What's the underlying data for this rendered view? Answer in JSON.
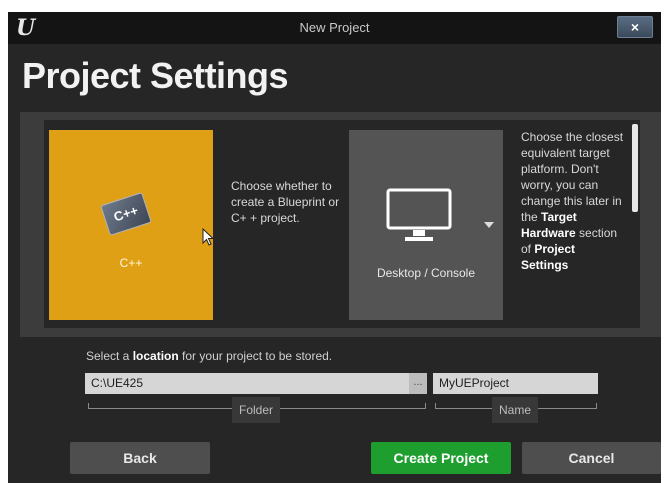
{
  "window": {
    "title": "New Project",
    "close_label": "×"
  },
  "heading": "Project Settings",
  "settings": {
    "project_type": {
      "tile_label": "C++",
      "icon_text": "C++",
      "icon": "cpp-icon",
      "selected": true,
      "description": "Choose whether to create a Blueprint or C+ + project."
    },
    "platform": {
      "tile_label": "Desktop / Console",
      "icon": "monitor-icon",
      "description_parts": [
        "Choose the closest equivalent target platform. Don't worry, you can change this later in the ",
        "Target Hardware",
        " section of ",
        "Project Settings"
      ]
    }
  },
  "location": {
    "prompt_before": "Select a ",
    "prompt_bold": "location",
    "prompt_after": " for your project to be stored.",
    "folder_value": "C:\\UE425",
    "browse_label": "...",
    "folder_caption": "Folder",
    "name_value": "MyUEProject",
    "name_caption": "Name"
  },
  "buttons": {
    "back": "Back",
    "create": "Create Project",
    "cancel": "Cancel"
  },
  "colors": {
    "accent_selected": "#e0a016",
    "create_button": "#1e9e2e"
  }
}
